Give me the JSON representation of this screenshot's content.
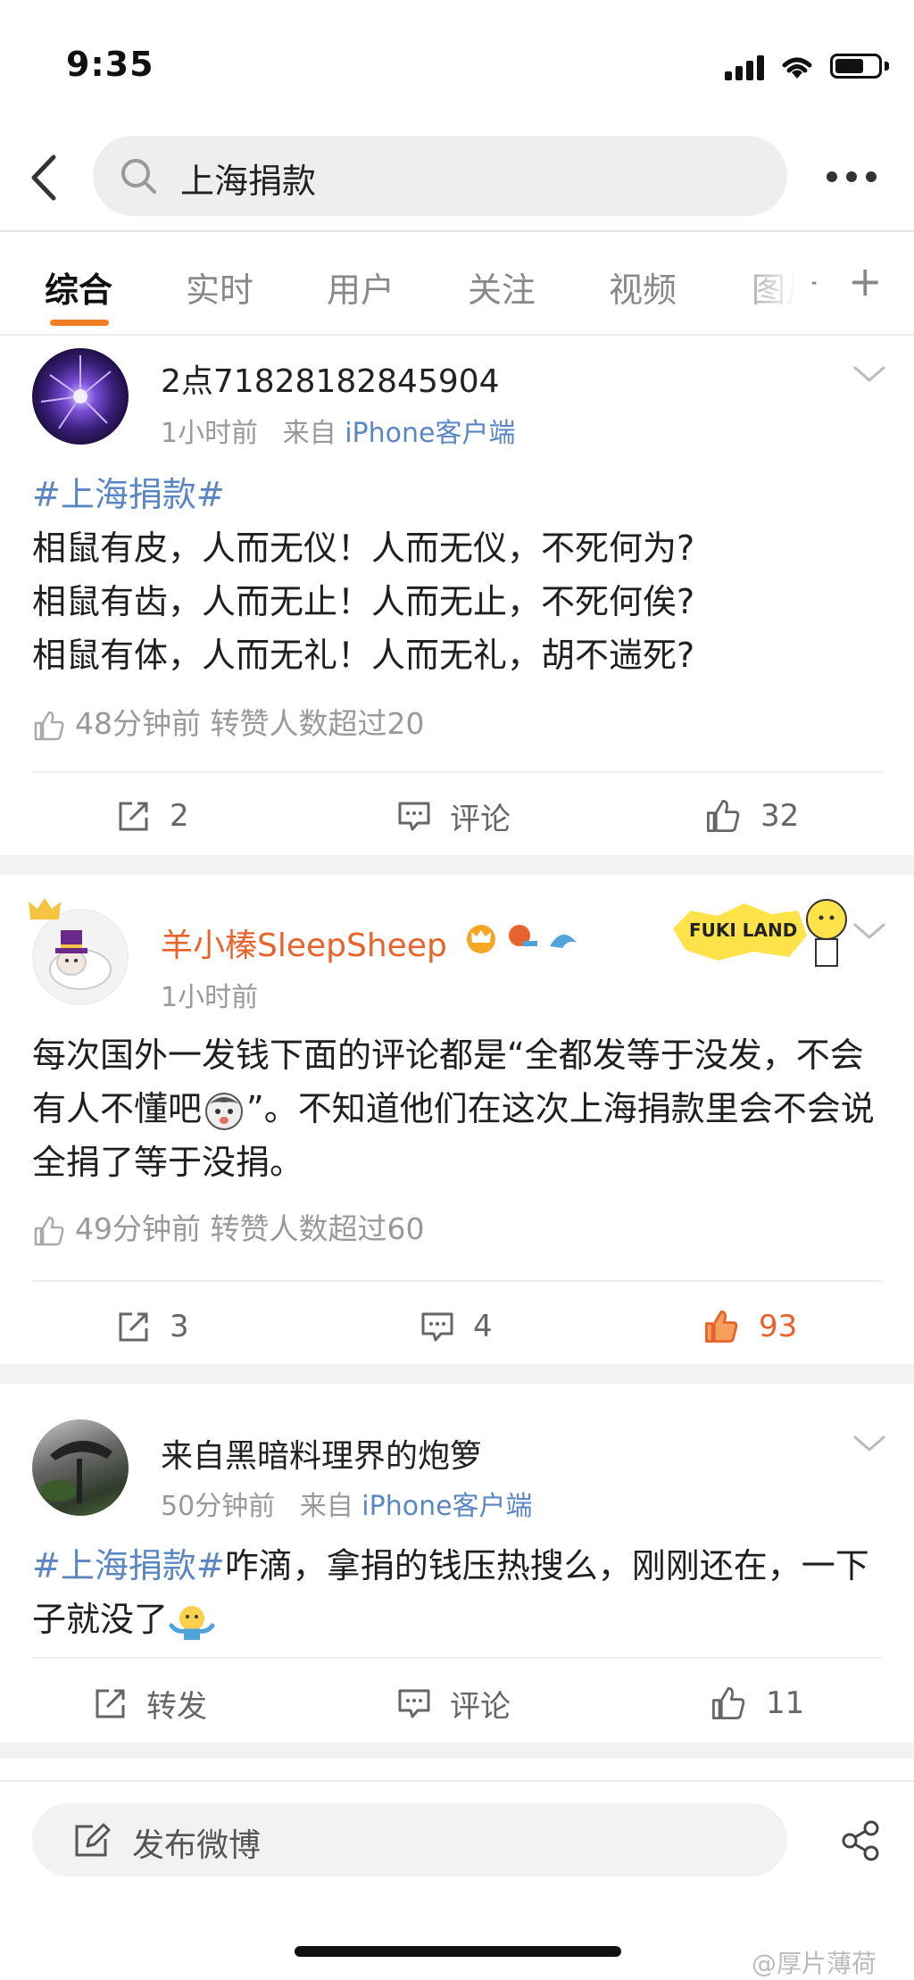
{
  "status_bar": {
    "time": "9:35"
  },
  "search": {
    "query": "上海捐款"
  },
  "tabs": [
    {
      "label": "综合",
      "active": true
    },
    {
      "label": "实时"
    },
    {
      "label": "用户"
    },
    {
      "label": "关注"
    },
    {
      "label": "视频"
    },
    {
      "label": "图片"
    }
  ],
  "posts": [
    {
      "username": "2点71828182845904",
      "time": "1小时前",
      "source_prefix": "来自",
      "source": "iPhone客户端",
      "hashtag": "#上海捐款#",
      "lines": [
        "相鼠有皮，人而无仪！人而无仪，不死何为?",
        "相鼠有齿，人而无止！人而无止，不死何俟?",
        "相鼠有体，人而无礼！人而无礼，胡不遄死?"
      ],
      "liked_info": "48分钟前 转赞人数超过20",
      "repost": "2",
      "comment": "评论",
      "like": "32"
    },
    {
      "username": "羊小榛SleepSheep",
      "time": "1小时前",
      "badge_text": "FUKI LAND",
      "text_a": "每次国外一发钱下面的评论都是“全都发等于没发，不会有人不懂吧",
      "text_b": "”。不知道他们在这次上海捐款里会不会说全捐了等于没捐。",
      "liked_info": "49分钟前 转赞人数超过60",
      "repost": "3",
      "comment": "4",
      "like": "93"
    },
    {
      "username": "来自黑暗料理界的炮箩",
      "time": "50分钟前",
      "source_prefix": "来自",
      "source": "iPhone客户端",
      "hashtag": "#上海捐款#",
      "text": "咋滴，拿捐的钱压热搜么，刚刚还在，一下子就没了",
      "repost": "转发",
      "comment": "评论",
      "like": "11"
    }
  ],
  "compose": {
    "label": "发布微博"
  },
  "watermark": "@厚片薄荷",
  "colors": {
    "accent": "#f07d24",
    "link": "#5a87c4",
    "liked": "#e8632b"
  }
}
